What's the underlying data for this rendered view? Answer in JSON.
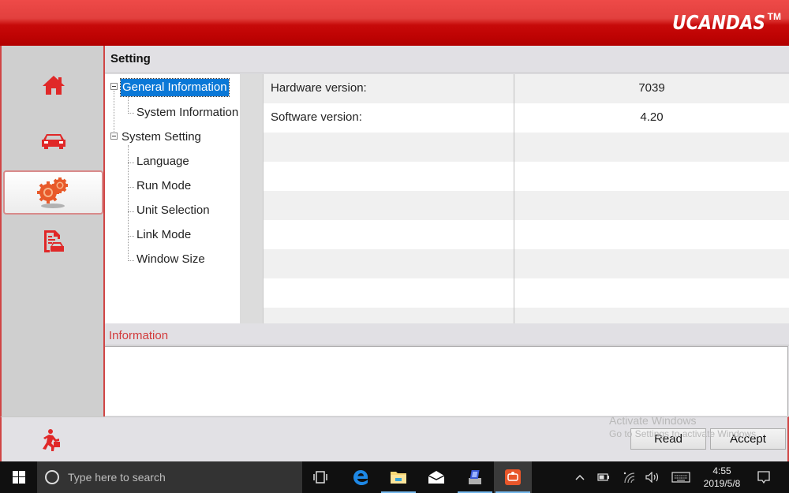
{
  "app": {
    "brand": "UCANDAS",
    "brand_tm": "TM",
    "accent_color": "#c00404",
    "sidebar": {
      "items": [
        {
          "name": "home",
          "icon": "home-icon",
          "active": false
        },
        {
          "name": "vehicle",
          "icon": "car-icon",
          "active": false
        },
        {
          "name": "settings",
          "icon": "gears-icon",
          "active": true
        },
        {
          "name": "report",
          "icon": "report-car-icon",
          "active": false
        }
      ]
    },
    "page_title": "Setting",
    "tree": {
      "nodes": [
        {
          "label": "General Information",
          "level": 0,
          "expanded": true,
          "selected": true
        },
        {
          "label": "System Information",
          "level": 1
        },
        {
          "label": "System Setting",
          "level": 0,
          "expanded": true
        },
        {
          "label": "Language",
          "level": 1
        },
        {
          "label": "Run Mode",
          "level": 1
        },
        {
          "label": "Unit Selection",
          "level": 1
        },
        {
          "label": "Link Mode",
          "level": 1
        },
        {
          "label": "Window Size",
          "level": 1
        }
      ],
      "scroll_left": "‹",
      "scroll_right": "›"
    },
    "grid": {
      "rows": [
        {
          "label": "Hardware version:",
          "value": "7039"
        },
        {
          "label": "Software version:",
          "value": "4.20"
        },
        {
          "label": "",
          "value": ""
        },
        {
          "label": "",
          "value": ""
        },
        {
          "label": "",
          "value": ""
        },
        {
          "label": "",
          "value": ""
        },
        {
          "label": "",
          "value": ""
        },
        {
          "label": "",
          "value": ""
        },
        {
          "label": "",
          "value": ""
        }
      ]
    },
    "information": {
      "label": "Information",
      "text": ""
    },
    "footer": {
      "read_label": "Read",
      "accept_label": "Accept"
    },
    "watermark": {
      "line1": "Activate Windows",
      "line2": "Go to Settings to activate Windows."
    }
  },
  "taskbar": {
    "search_placeholder": "Type here to search",
    "apps": [
      {
        "name": "task-view",
        "running": false
      },
      {
        "name": "edge",
        "running": false
      },
      {
        "name": "file-explorer",
        "running": true
      },
      {
        "name": "mail",
        "running": false
      },
      {
        "name": "network-app",
        "running": true
      },
      {
        "name": "ucandas",
        "running": true,
        "active": true
      }
    ],
    "time": "4:55",
    "date": "2019/5/8"
  }
}
